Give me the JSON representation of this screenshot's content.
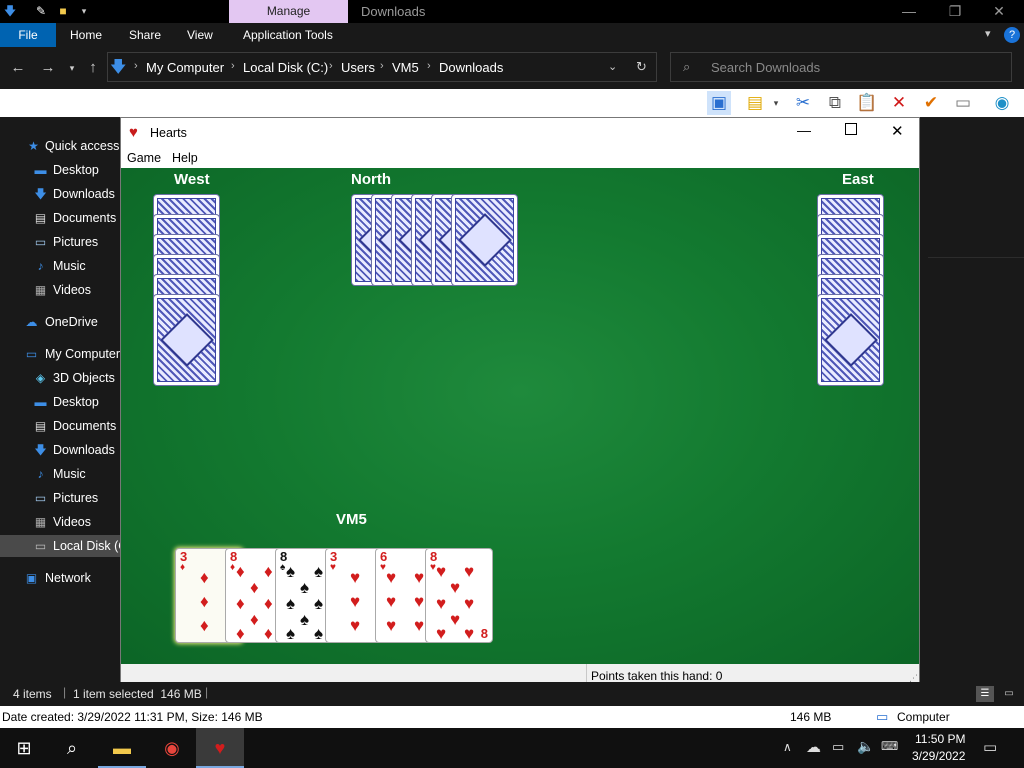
{
  "explorer": {
    "contextual_tab": "Manage",
    "window_title": "Downloads",
    "ribbon_tabs": [
      "File",
      "Home",
      "Share",
      "View",
      "Application Tools"
    ],
    "breadcrumb": [
      "My Computer",
      "Local Disk (C:)",
      "Users",
      "VM5",
      "Downloads"
    ],
    "search_placeholder": "Search Downloads",
    "nav": {
      "quick_access": "Quick access",
      "qa_items": [
        "Desktop",
        "Downloads",
        "Documents",
        "Pictures",
        "Music",
        "Videos"
      ],
      "onedrive": "OneDrive",
      "my_computer": "My Computer",
      "pc_items": [
        "3D Objects",
        "Desktop",
        "Documents",
        "Downloads",
        "Music",
        "Pictures",
        "Videos",
        "Local Disk (C"
      ],
      "network": "Network"
    },
    "status": {
      "items": "4 items",
      "selected": "1 item selected  146 MB"
    },
    "details": {
      "text": "Date created: 3/29/2022 11:31 PM, Size: 146 MB",
      "size": "146 MB",
      "location": "Computer"
    }
  },
  "hearts": {
    "title": "Hearts",
    "menu": [
      "Game",
      "Help"
    ],
    "players": {
      "west": "West",
      "north": "North",
      "east": "East",
      "south": "VM5"
    },
    "status": "Points taken this hand: 0",
    "hand": [
      {
        "rank": "3",
        "suit": "♦",
        "color": "red"
      },
      {
        "rank": "8",
        "suit": "♦",
        "color": "red"
      },
      {
        "rank": "8",
        "suit": "♠",
        "color": "black"
      },
      {
        "rank": "3",
        "suit": "♥",
        "color": "red"
      },
      {
        "rank": "6",
        "suit": "♥",
        "color": "red"
      },
      {
        "rank": "8",
        "suit": "♥",
        "color": "red"
      }
    ]
  },
  "taskbar": {
    "time": "11:50 PM",
    "date": "3/29/2022"
  },
  "colors": {
    "accent": "#0063b1",
    "felt": "#137a30",
    "manage": "#e3c7f2",
    "red_suit": "#d21d1d"
  }
}
